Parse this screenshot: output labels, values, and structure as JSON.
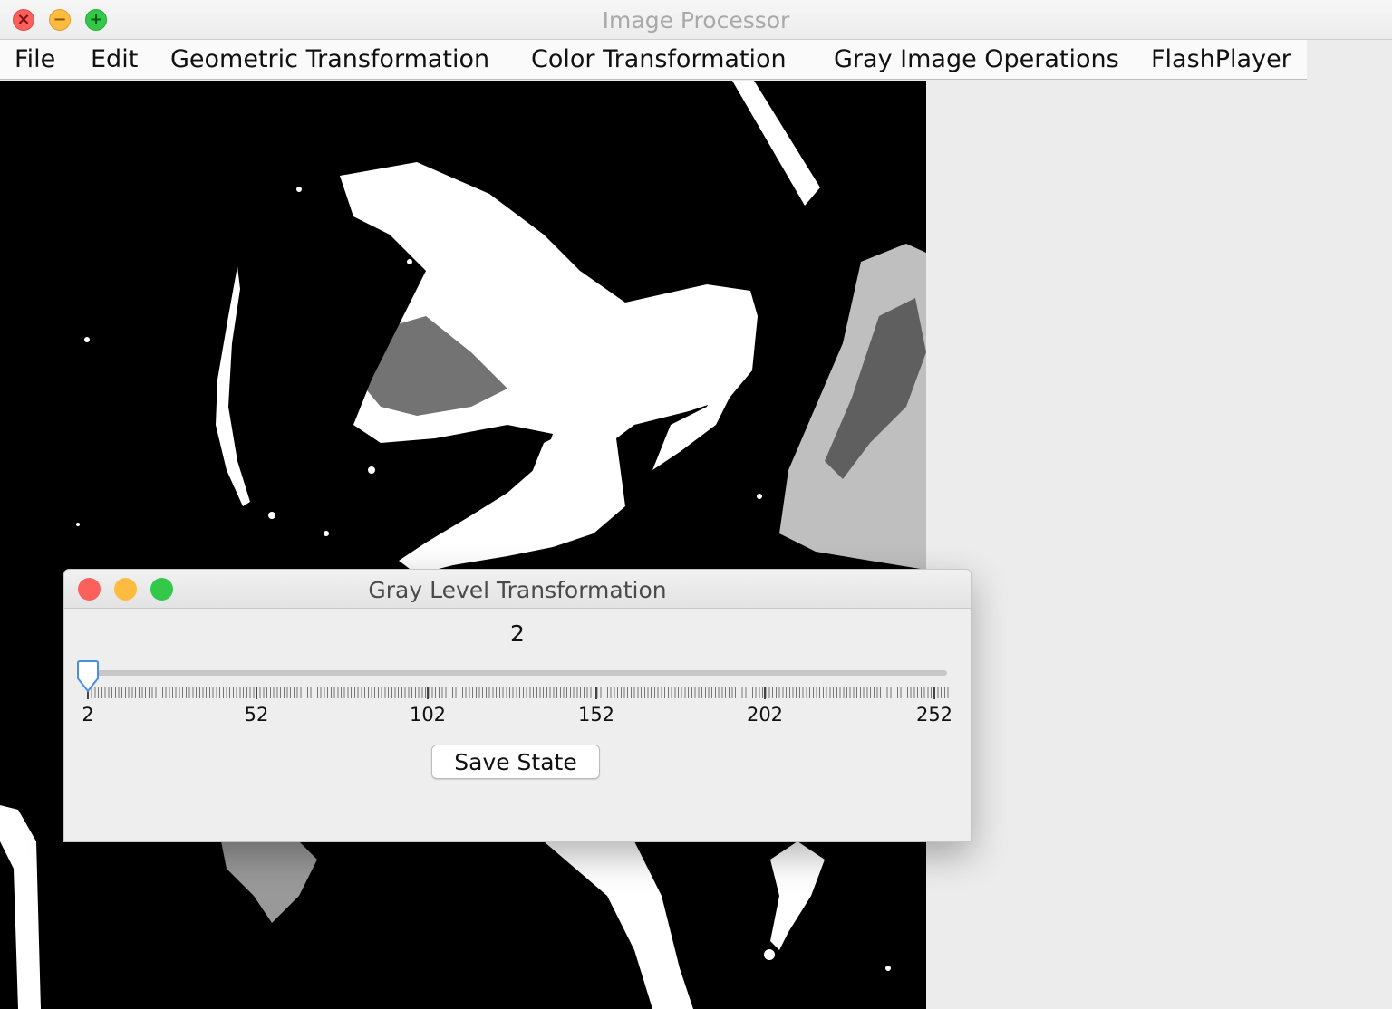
{
  "window": {
    "title": "Image Processor"
  },
  "menu": [
    "File",
    "Edit",
    "Geometric Transformation",
    "Color Transformation",
    "Gray Image Operations",
    "FlashPlayer"
  ],
  "dialog": {
    "title": "Gray Level Transformation",
    "value": "2",
    "slider": {
      "min": 2,
      "max": 252,
      "value": 2,
      "tick_labels": [
        "2",
        "52",
        "102",
        "152",
        "202",
        "252"
      ]
    },
    "save_label": "Save State"
  },
  "colors": {
    "close": "#fc605c",
    "minimize": "#fdbc40",
    "zoom": "#34c84a",
    "slider_thumb": "#4a90e2"
  },
  "icons": [
    "close-icon",
    "minimize-icon",
    "zoom-icon",
    "slider-thumb-icon"
  ]
}
